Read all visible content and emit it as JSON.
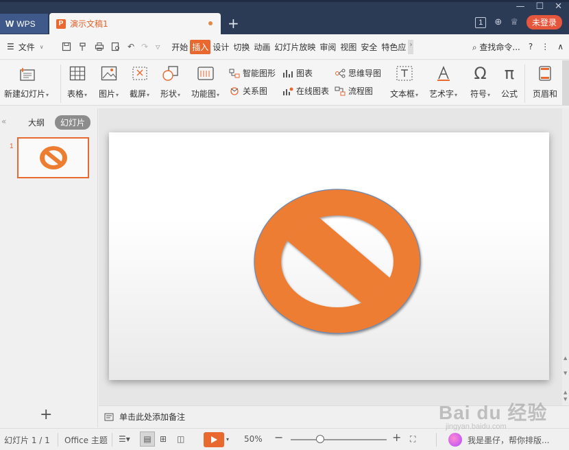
{
  "titlebar": {
    "wps_label": "WPS",
    "doc_tab_label": "演示文稿1",
    "new_tab": "+",
    "badge_number": "1",
    "login_label": "未登录"
  },
  "menubar": {
    "file_label": "文件",
    "items": [
      "开始",
      "插入",
      "设计",
      "切换",
      "动画",
      "幻灯片放映",
      "审阅",
      "视图",
      "安全",
      "特色应"
    ],
    "active_item": "插入",
    "search_label": "查找命令...",
    "help": "?"
  },
  "ribbon": {
    "new_slide": "新建幻灯片",
    "table": "表格",
    "picture": "图片",
    "screenshot": "截屏",
    "shape": "形状",
    "function_chart": "功能图",
    "smart_graphic": "智能图形",
    "chart": "图表",
    "mind_map": "思维导图",
    "relation_chart": "关系图",
    "online_chart": "在线图表",
    "flowchart": "流程图",
    "textbox": "文本框",
    "wordart": "艺术字",
    "symbol": "符号",
    "formula": "公式",
    "header_footer": "页眉和"
  },
  "leftpanel": {
    "outline_tab": "大纲",
    "slides_tab": "幻灯片",
    "slide_number": "1"
  },
  "slide": {
    "shape_fill": "#ed7d31",
    "shape_outline": "#6a8ab5"
  },
  "notes": {
    "placeholder": "单击此处添加备注"
  },
  "statusbar": {
    "slide_info": "幻灯片 1 / 1",
    "theme": "Office 主题",
    "zoom": "50%",
    "zoom_level": 0.5,
    "assistant": "我是墨仔，帮你排版..."
  },
  "watermark": {
    "brand": "Bai  du 经验",
    "url": "jingyan.baidu.com"
  },
  "colors": {
    "titlebar_bg": "#2b3a55",
    "accent": "#e8682f",
    "login": "#e5573d"
  }
}
